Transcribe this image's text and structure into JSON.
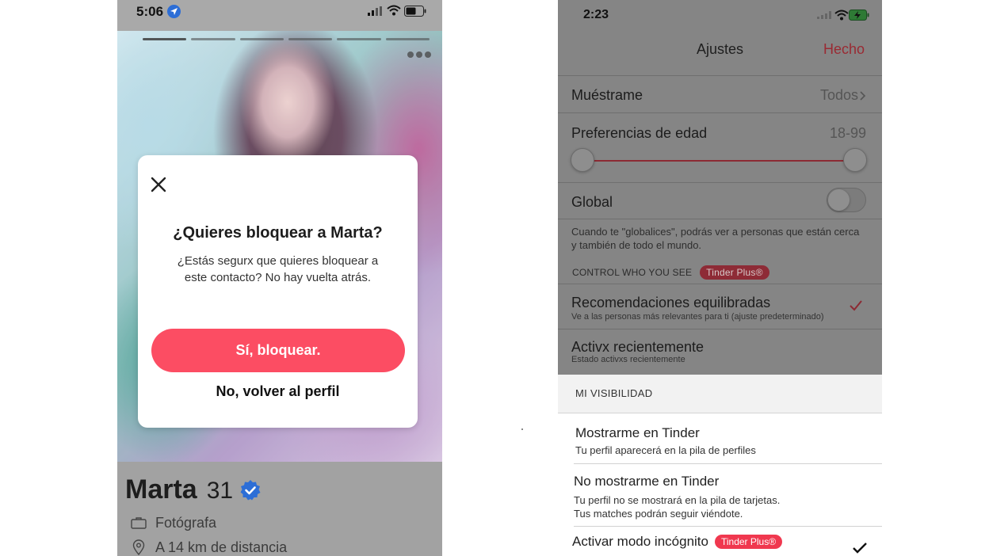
{
  "left": {
    "status": {
      "time": "5:06"
    },
    "profile": {
      "name": "Marta",
      "age": "31",
      "job": "Fotógrafa",
      "distance": "A 14 km de distancia",
      "photo_count": 6,
      "active_photo": 1
    },
    "modal": {
      "title": "¿Quieres bloquear a Marta?",
      "body": "¿Estás segurx que quieres bloquear a este contacto? No hay vuelta atrás.",
      "confirm_label": "Sí, bloquear.",
      "cancel_label": "No, volver al perfil"
    }
  },
  "right": {
    "status": {
      "time": "2:23"
    },
    "nav": {
      "title": "Ajustes",
      "done_label": "Hecho"
    },
    "settings": {
      "show_me": {
        "label": "Muéstrame",
        "value": "Todos"
      },
      "age_pref": {
        "label": "Preferencias de edad",
        "value": "18-99"
      },
      "global": {
        "label": "Global",
        "enabled": false
      },
      "global_helper": "Cuando te \"globalices\", podrás ver a personas que están cerca y también de todo el mundo.",
      "control_header": "CONTROL WHO YOU SEE",
      "tinder_plus_badge": "Tinder Plus®",
      "balanced": {
        "label": "Recomendaciones equilibradas",
        "sub": "Ve a las personas más relevantes para ti (ajuste predeterminado)",
        "checked": true
      },
      "recent": {
        "label": "Activx recientemente",
        "sub": "Estado activxs recientemente"
      }
    },
    "visibility": {
      "header": "MI VISIBILIDAD",
      "show": {
        "label": "Mostrarme en Tinder",
        "sub": "Tu perfil aparecerá en la pila de perfiles"
      },
      "hide": {
        "label": "No mostrarme en Tinder",
        "sub1": "Tu perfil no se mostrará en la pila de tarjetas.",
        "sub2": "Tus matches podrán seguir viéndote."
      },
      "incognito": {
        "label": "Activar modo incógnito",
        "badge": "Tinder Plus®",
        "checked": true
      }
    }
  },
  "colors": {
    "brand": "#fc4d63",
    "badge": "#f0384f",
    "verified": "#2d6ed6"
  }
}
